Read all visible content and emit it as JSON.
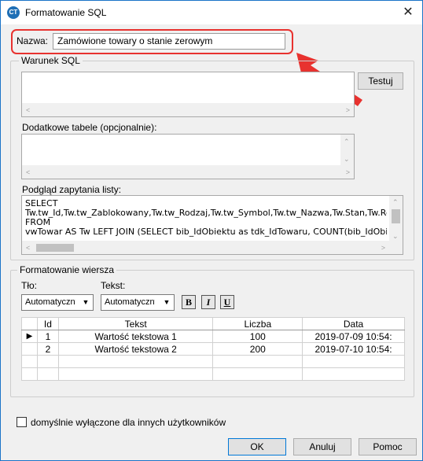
{
  "window": {
    "title": "Formatowanie SQL",
    "close": "✕",
    "app_icon_text": "CT"
  },
  "name_field": {
    "label": "Nazwa:",
    "value": "Zamówione towary o stanie zerowym"
  },
  "sql_condition": {
    "group_title": "Warunek SQL",
    "test_button": "Testuj",
    "extra_tables_label": "Dodatkowe tabele (opcjonalnie):",
    "preview_label": "Podgląd zapytania listy:",
    "preview_lines": [
      "SELECT",
      "Tw.tw_Id,Tw.tw_Zablokowany,Tw.tw_Rodzaj,Tw.tw_Symbol,Tw.tw_Nazwa,Tw.Stan,Tw.Rezer",
      "FROM",
      "vwTowar AS Tw LEFT JOIN (SELECT bib_IdObiektu as tdk_IdTowaru, COUNT(bib_IdObiektu) AS"
    ]
  },
  "row_format": {
    "group_title": "Formatowanie wiersza",
    "bg_label": "Tło:",
    "text_label": "Tekst:",
    "bg_value": "Automatyczny",
    "text_value": "Automatyczny",
    "bold": "B",
    "italic": "I",
    "underline": "U"
  },
  "grid": {
    "columns": [
      "Id",
      "Tekst",
      "Liczba",
      "Data"
    ],
    "rows": [
      {
        "id": "1",
        "text": "Wartość tekstowa 1",
        "number": "100",
        "date": "2019-07-09 10:54:",
        "current": true
      },
      {
        "id": "2",
        "text": "Wartość tekstowa 2",
        "number": "200",
        "date": "2019-07-10 10:54:",
        "current": false
      }
    ],
    "row_indicator": "▶"
  },
  "checkbox": {
    "label": "domyślnie wyłączone dla innych użytkowników",
    "checked": false
  },
  "buttons": {
    "ok": "OK",
    "cancel": "Anuluj",
    "help": "Pomoc"
  },
  "colors": {
    "highlight": "#e8322f",
    "accent": "#0078d7"
  }
}
